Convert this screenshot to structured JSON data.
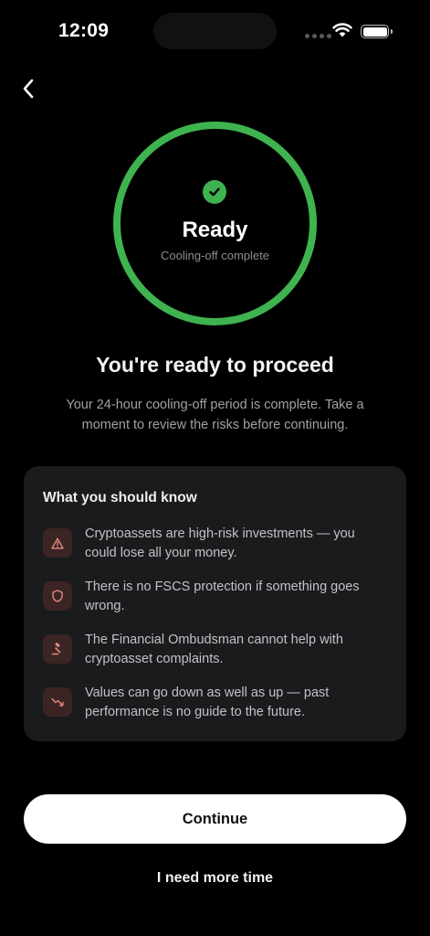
{
  "status_bar": {
    "time": "12:09"
  },
  "nav": {
    "back_icon": "chevron-left-icon"
  },
  "status_ring": {
    "icon": "check-circle-icon",
    "title": "Ready",
    "subtitle": "Cooling-off complete",
    "ring_color": "#3fb34f",
    "progress": 1.0
  },
  "heading": "You're ready to proceed",
  "intro": "Your 24-hour cooling-off period is complete. Take a moment to review the risks before continuing.",
  "risks": {
    "title": "What you should know",
    "items": [
      {
        "icon": "warning-triangle-icon",
        "text": "Cryptoassets are high-risk investments — you could lose all your money."
      },
      {
        "icon": "shield-icon",
        "text": "There is no FSCS protection if something goes wrong."
      },
      {
        "icon": "gavel-icon",
        "text": "The Financial Ombudsman cannot help with cryptoasset complaints."
      },
      {
        "icon": "trending-down-icon",
        "text": "Values can go down as well as up — past performance is no guide to the future."
      }
    ],
    "icon_color": "#e8897f"
  },
  "actions": {
    "continue_label": "Continue",
    "more_time_label": "I need more time"
  }
}
